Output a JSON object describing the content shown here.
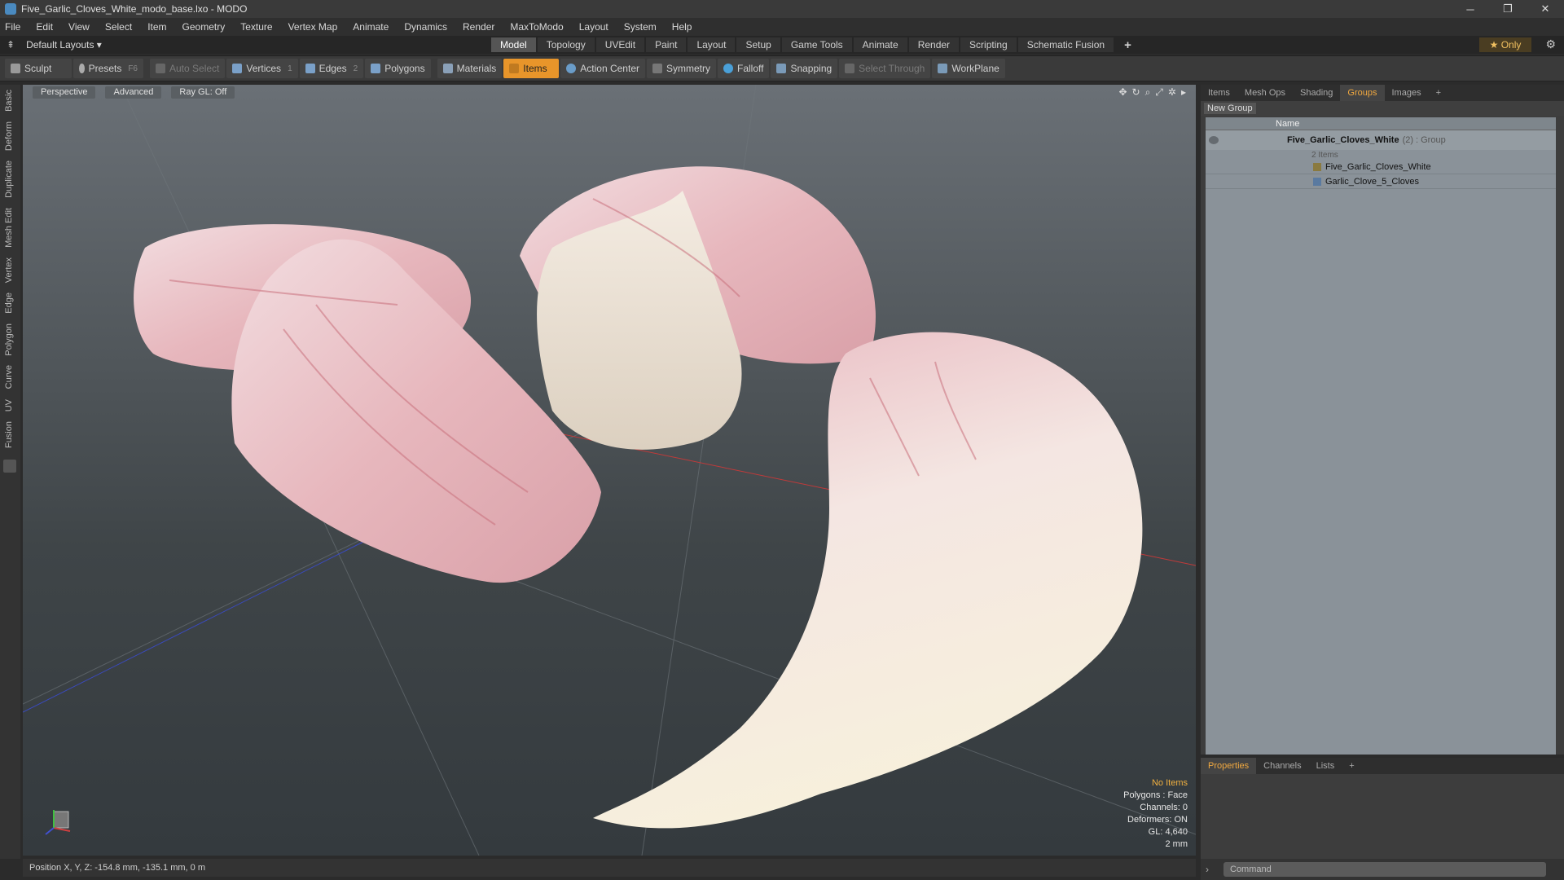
{
  "window": {
    "title": "Five_Garlic_Cloves_White_modo_base.lxo - MODO"
  },
  "menu": [
    "File",
    "Edit",
    "View",
    "Select",
    "Item",
    "Geometry",
    "Texture",
    "Vertex Map",
    "Animate",
    "Dynamics",
    "Render",
    "MaxToModo",
    "Layout",
    "System",
    "Help"
  ],
  "layout": {
    "name": "Default Layouts ▾"
  },
  "mode_tabs": [
    "Model",
    "Topology",
    "UVEdit",
    "Paint",
    "Layout",
    "Setup",
    "Game Tools",
    "Animate",
    "Render",
    "Scripting",
    "Schematic Fusion"
  ],
  "active_mode": "Model",
  "only_label": "★  Only",
  "toolbar": {
    "sculpt": "Sculpt",
    "presets": "Presets",
    "presets_key": "F6",
    "auto_select": "Auto Select",
    "vertices": "Vertices",
    "vertices_num": "1",
    "edges": "Edges",
    "edges_num": "2",
    "polygons": "Polygons",
    "materials": "Materials",
    "items": "Items",
    "action_center": "Action Center",
    "symmetry": "Symmetry",
    "falloff": "Falloff",
    "snapping": "Snapping",
    "select_through": "Select Through",
    "workplane": "WorkPlane"
  },
  "left_tabs": [
    "Basic",
    "Deform",
    "Duplicate",
    "Mesh Edit",
    "Vertex",
    "Edge",
    "Polygon",
    "Curve",
    "UV",
    "Fusion"
  ],
  "viewport": {
    "view": "Perspective",
    "shading": "Advanced",
    "raygl": "Ray GL: Off",
    "info": {
      "no_items": "No Items",
      "polygons": "Polygons : Face",
      "channels": "Channels: 0",
      "deformers": "Deformers: ON",
      "gl": "GL: 4,640",
      "scale": "2 mm"
    }
  },
  "status": {
    "position": "Position X, Y, Z:  -154.8 mm, -135.1 mm, 0 m"
  },
  "right_panel": {
    "tabs": [
      "Items",
      "Mesh Ops",
      "Shading",
      "Groups",
      "Images"
    ],
    "active_tab": "Groups",
    "new_group": "New Group",
    "column_name": "Name",
    "group": {
      "name": "Five_Garlic_Cloves_White",
      "count": "(2)",
      "type": ": Group",
      "subtitle": "2 Items"
    },
    "children": [
      "Five_Garlic_Cloves_White",
      "Garlic_Clove_5_Cloves"
    ]
  },
  "bottom_panel": {
    "tabs": [
      "Properties",
      "Channels",
      "Lists"
    ],
    "active_tab": "Properties"
  },
  "command": {
    "placeholder": "Command"
  }
}
